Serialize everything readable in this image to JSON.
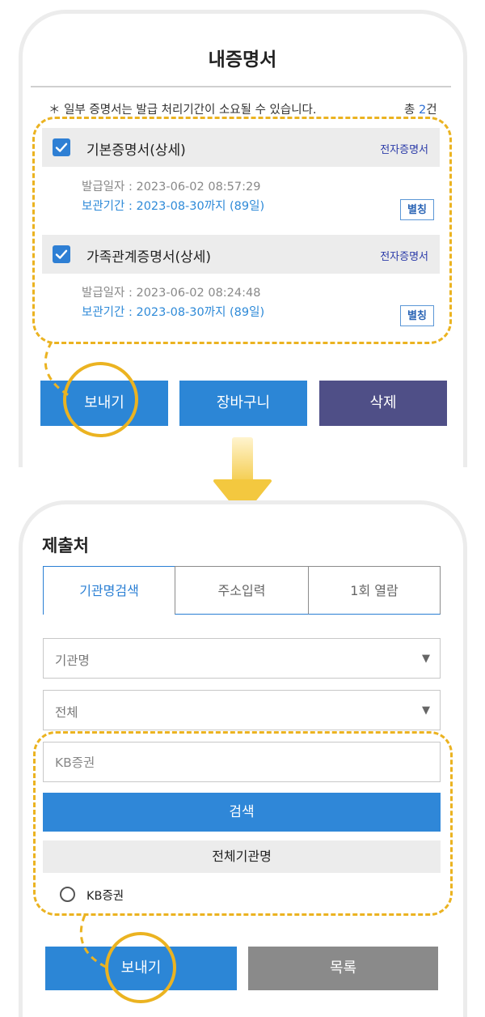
{
  "screen1": {
    "title": "내증명서",
    "notice": "＊ 일부 증명서는 발급 처리기간이 소요될 수 있습니다.",
    "total_prefix": "총 ",
    "total_count": "2",
    "total_suffix": "건",
    "certificates": [
      {
        "name": "기본증명서(상세)",
        "type": "전자증명서",
        "issue_date": "발급일자 : 2023-06-02 08:57:29",
        "retention": "보관기간 : 2023-08-30까지 (89일)",
        "alias_label": "별칭",
        "checked": true
      },
      {
        "name": "가족관계증명서(상세)",
        "type": "전자증명서",
        "issue_date": "발급일자 : 2023-06-02 08:24:48",
        "retention": "보관기간 : 2023-08-30까지 (89일)",
        "alias_label": "별칭",
        "checked": true
      }
    ],
    "buttons": {
      "send": "보내기",
      "cart": "장바구니",
      "delete": "삭제"
    }
  },
  "screen2": {
    "title": "제출처",
    "tabs": [
      "기관명검색",
      "주소입력",
      "1회 열람"
    ],
    "active_tab": "기관명검색",
    "select_institution": "기관명",
    "select_region": "전체",
    "search_value": "KB증권",
    "search_button": "검색",
    "all_institutions": "전체기관명",
    "result_option": "KB증권",
    "buttons": {
      "send": "보내기",
      "list": "목록"
    }
  },
  "colors": {
    "primary_blue": "#2c86d6",
    "delete_purple": "#4f4f87",
    "list_gray": "#8a8a8a",
    "annotation_yellow": "#ebb321"
  },
  "icons": [
    "checkbox-checked-icon",
    "dropdown-arrow-icon",
    "radio-icon",
    "down-arrow-icon"
  ]
}
